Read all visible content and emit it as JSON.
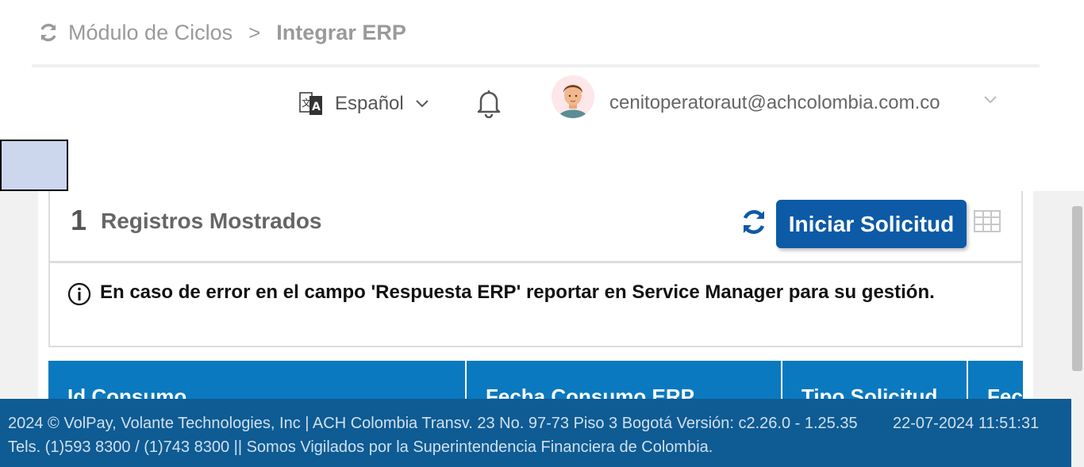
{
  "breadcrumb": {
    "module": "Módulo de Ciclos",
    "separator": ">",
    "current": "Integrar ERP"
  },
  "header": {
    "language": "Español",
    "user_email": "cenitoperatoraut@achcolombia.com.co"
  },
  "records": {
    "count": "1",
    "label": "Registros Mostrados",
    "start_button": "Iniciar Solicitud"
  },
  "notice": {
    "text": "En caso de error en el campo 'Respuesta ERP' reportar en Service Manager para su gestión."
  },
  "table": {
    "columns": [
      "Id Consumo",
      "Fecha Consumo ERP",
      "Tipo Solicitud",
      "Fec"
    ]
  },
  "footer": {
    "line1": "2024 © VolPay, Volante Technologies, Inc | ACH Colombia Transv. 23 No. 97-73 Piso 3 Bogotá  Versión: c2.26.0 - 1.25.35",
    "datetime": "22-07-2024 11:51:31",
    "line2": "Tels. (1)593 8300 / (1)743 8300 || Somos Vigilados por la Superintendencia Financiera de Colombia."
  },
  "colors": {
    "primary_button": "#0d5aa7",
    "table_header": "#0a79bf",
    "footer_bg": "#0f5b93"
  }
}
